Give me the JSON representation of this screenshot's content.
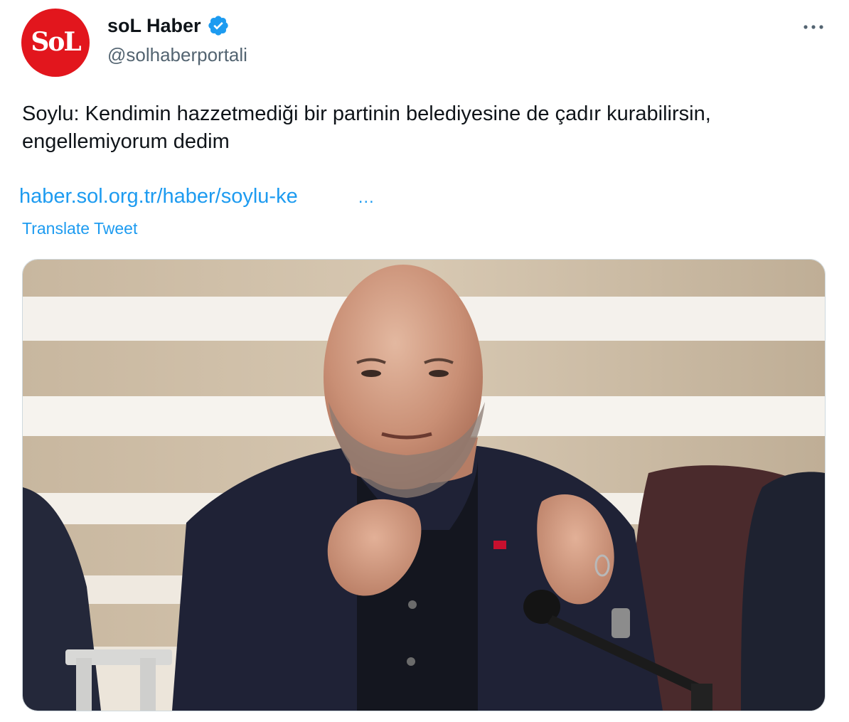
{
  "tweet": {
    "author": {
      "display_name": "soL Haber",
      "handle": "@solhaberportali",
      "avatar_text": "SoL",
      "verified_icon": "verified-badge-icon",
      "brand_color": "#e2161d"
    },
    "more_icon": "more-horizontal-icon",
    "text": "Soylu: Kendimin hazzetmediği bir partinin belediyesine de çadır kurabilirsin, engellemiyorum dedim",
    "link": {
      "display": "haber.sol.org.tr/haber/soylu-ke",
      "ellipsis": "…"
    },
    "translate_label": "Translate Tweet",
    "colors": {
      "link": "#1d9bf0",
      "text": "#0f1419",
      "secondary": "#536471",
      "verified": "#1d9bf0"
    }
  }
}
